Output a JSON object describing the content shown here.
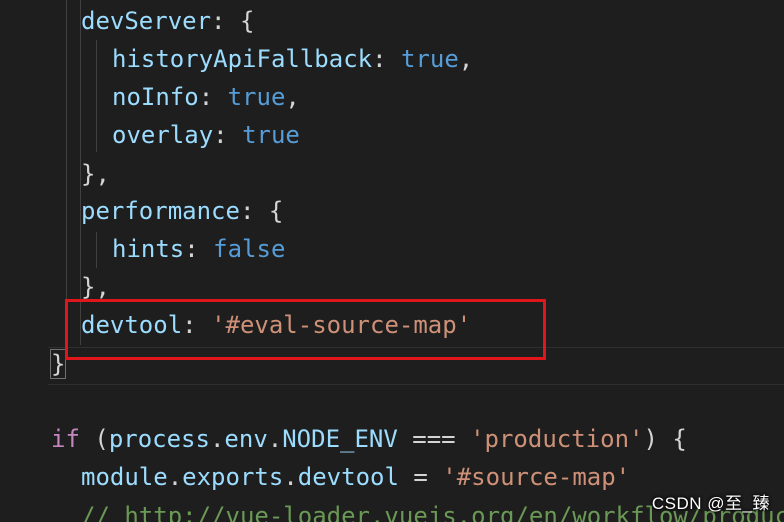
{
  "code_lines": [
    {
      "key": "devServer",
      "after": ": {"
    },
    {
      "key": "historyApiFallback",
      "sep": ": ",
      "value": "true",
      "after": ","
    },
    {
      "key": "noInfo",
      "sep": ": ",
      "value": "true",
      "after": ","
    },
    {
      "key": "overlay",
      "sep": ": ",
      "value": "true"
    },
    {
      "text": "},"
    },
    {
      "key": "performance",
      "after": ": {"
    },
    {
      "key": "hints",
      "sep": ": ",
      "value": "false"
    },
    {
      "text": "},"
    },
    {
      "key": "devtool",
      "sep": ": ",
      "string": "'#eval-source-map'"
    },
    {
      "text": "}"
    },
    {
      "kw": "if",
      "open": " (",
      "obj": "process",
      "dot1": ".",
      "obj2": "env",
      "dot2": ".",
      "obj3": "NODE_ENV",
      "op": " === ",
      "string": "'production'",
      "close": ") {"
    },
    {
      "obj": "module",
      "dot1": ".",
      "obj2": "exports",
      "dot2": ".",
      "obj3": "devtool",
      "op": " = ",
      "string": "'#source-map'"
    },
    {
      "comment": "// http://vue-loader.vuejs.org/en/workflow/production.html"
    }
  ],
  "watermark": "CSDN @至_臻",
  "colors": {
    "background": "#1e1e1e",
    "property": "#9cdcfe",
    "keyword": "#569cd6",
    "control": "#c586c0",
    "string": "#ce9178",
    "comment": "#6a9955",
    "highlight_box": "#e0161d"
  }
}
